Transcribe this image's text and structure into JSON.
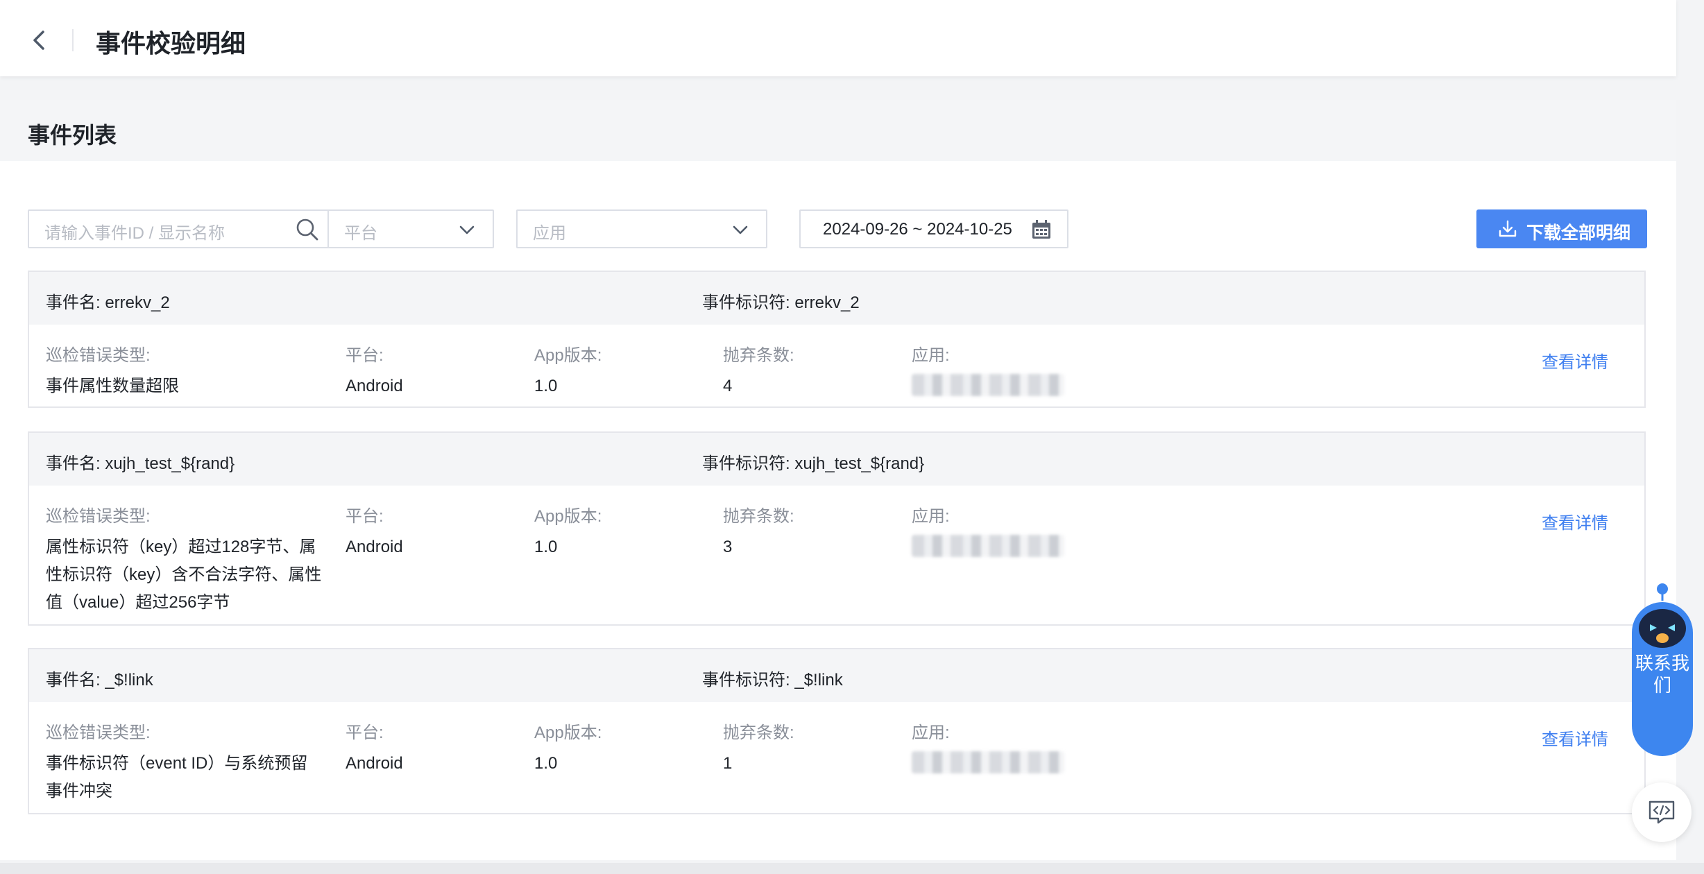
{
  "header": {
    "title": "事件校验明细"
  },
  "section": {
    "title": "事件列表"
  },
  "filters": {
    "search_placeholder": "请输入事件ID / 显示名称",
    "platform_placeholder": "平台",
    "app_placeholder": "应用",
    "date_range": "2024-09-26 ~ 2024-10-25",
    "download_label": "下载全部明细"
  },
  "labels": {
    "event_name": "事件名: ",
    "event_id": "事件标识符: ",
    "error_type": "巡检错误类型:",
    "platform": "平台:",
    "app_version": "App版本:",
    "discarded": "抛弃条数:",
    "app": "应用:",
    "detail_link": "查看详情"
  },
  "events": [
    {
      "name": "事件名: errekv_2",
      "identifier": "事件标识符: errekv_2",
      "error_type": "事件属性数量超限",
      "platform": "Android",
      "app_version": "1.0",
      "discarded": "4"
    },
    {
      "name": "事件名: xujh_test_${rand}",
      "identifier": "事件标识符: xujh_test_${rand}",
      "error_type": "属性标识符（key）超过128字节、属性标识符（key）含不合法字符、属性值（value）超过256字节",
      "platform": "Android",
      "app_version": "1.0",
      "discarded": "3"
    },
    {
      "name": "事件名: _$!link",
      "identifier": "事件标识符: _$!link",
      "error_type": "事件标识符（event ID）与系统预留事件冲突",
      "platform": "Android",
      "app_version": "1.0",
      "discarded": "1"
    }
  ],
  "widget": {
    "contact_label": "联系我们"
  },
  "colors": {
    "primary": "#4a87f2",
    "link": "#3f7ff0",
    "header_bg": "#f4f5f7",
    "widget": "#3d86ef"
  }
}
